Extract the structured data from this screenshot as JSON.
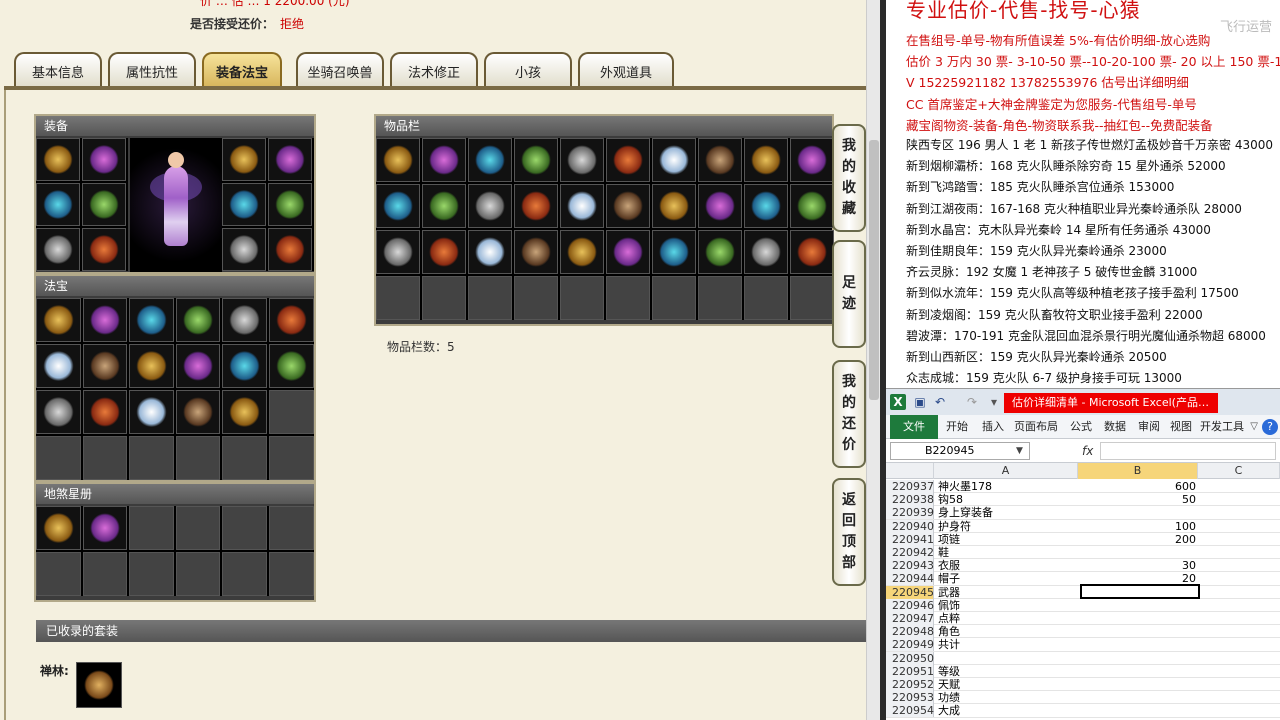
{
  "game": {
    "top_cut_text": "价 … 估 … 1 2200.00 (元)",
    "offer_label": "是否接受还价：",
    "offer_value": "拒绝",
    "tabs": [
      "基本信息",
      "属性抗性",
      "装备法宝",
      "坐骑召唤兽",
      "法术修正",
      "小孩",
      "外观道具"
    ],
    "active_tab": "装备法宝",
    "panels": {
      "equipment": "装备",
      "treasures": "法宝",
      "star_book": "地煞星册",
      "inventory": "物品栏",
      "suits": "已收录的套装"
    },
    "inventory_count": "物品栏数：5",
    "suit_row_label": "禅林:",
    "side_buttons": [
      {
        "chars": [
          "我",
          "的",
          "收",
          "藏"
        ]
      },
      {
        "chars": [
          "足",
          "迹"
        ]
      },
      {
        "chars": [
          "我",
          "的",
          "还",
          "价"
        ]
      },
      {
        "chars": [
          "返",
          "回",
          "顶",
          "部"
        ]
      }
    ]
  },
  "doc": {
    "heading": "专业估价-代售-找号-心猿",
    "lines": [
      {
        "text": "在售组号-单号-物有所值误差 5%-有估价明细-放心选购",
        "red": true
      },
      {
        "text": "估价 3 万内 30 票- 3-10-50 票--10-20-100 票- 20 以上 150 票-1 票 1 元",
        "red": true
      },
      {
        "text": "V 15225921182    13782553976    估号出详细明细",
        "red": true
      },
      {
        "text": "CC 首席鉴定+大神金牌鉴定为您服务-代售组号-单号",
        "red": true
      },
      {
        "text": "藏宝阁物资-装备-角色-物资联系我--抽红包--免费配装备",
        "red": true
      },
      {
        "text": "陕西专区 196 男人 1 老 1 新孩子传世燃灯孟极妙音千万亲密 43000",
        "red": false
      },
      {
        "text": "新到烟柳灞桥：168 克火队睡杀除穷奇 15 星外通杀 52000",
        "red": false
      },
      {
        "text": "新到飞鸿踏雪：185 克火队睡杀宫位通杀 153000",
        "red": false
      },
      {
        "text": "新到江湖夜雨：167-168 克火种植职业异光秦岭通杀队 28000",
        "red": false
      },
      {
        "text": "新到水晶宫：克木队异光秦岭 14 星所有任务通杀 43000",
        "red": false
      },
      {
        "text": "新到佳期良年：159 克火队异光秦岭通杀 23000",
        "red": false
      },
      {
        "text": "齐云灵脉：192 女魔 1 老神孩子 5 破传世金麟 31000",
        "red": false
      },
      {
        "text": "新到似水流年：159 克火队高等级种植老孩子接手盈利 17500",
        "red": false
      },
      {
        "text": "新到凌烟阁：159 克火队畜牧符文职业接手盈利 22000",
        "red": false
      },
      {
        "text": "碧波潭：170-191 克金队混回血混杀景行明光魔仙通杀物超 68000",
        "red": false
      },
      {
        "text": "新到山西新区：159 克火队异光秦岭通杀 20500",
        "red": false
      },
      {
        "text": "众志成城：159 克火队 6-7 级护身接手可玩 13000",
        "red": false
      }
    ],
    "watermark": "飞行运营"
  },
  "excel": {
    "title": "估价详细清单 - Microsoft Excel(产品…",
    "ribbon_tabs": [
      "文件",
      "开始",
      "插入",
      "页面布局",
      "公式",
      "数据",
      "审阅",
      "视图",
      "开发工具"
    ],
    "name_box": "B220945",
    "fx_label": "fx",
    "columns": [
      "A",
      "B",
      "C"
    ],
    "rows": [
      {
        "n": "220937",
        "a": "神火墨178",
        "b": "600"
      },
      {
        "n": "220938",
        "a": "钩58",
        "b": "50"
      },
      {
        "n": "220939",
        "a": "身上穿装备",
        "b": ""
      },
      {
        "n": "220940",
        "a": "护身符",
        "b": "100"
      },
      {
        "n": "220941",
        "a": "项链",
        "b": "200"
      },
      {
        "n": "220942",
        "a": "鞋",
        "b": ""
      },
      {
        "n": "220943",
        "a": "衣服",
        "b": "30"
      },
      {
        "n": "220944",
        "a": "帽子",
        "b": "20"
      },
      {
        "n": "220945",
        "a": "武器",
        "b": ""
      },
      {
        "n": "220946",
        "a": "佩饰",
        "b": ""
      },
      {
        "n": "220947",
        "a": "点粹",
        "b": ""
      },
      {
        "n": "220948",
        "a": "角色",
        "b": ""
      },
      {
        "n": "220949",
        "a": "共计",
        "b": ""
      },
      {
        "n": "220950",
        "a": "",
        "b": ""
      },
      {
        "n": "220951",
        "a": "等级",
        "b": ""
      },
      {
        "n": "220952",
        "a": "天赋",
        "b": ""
      },
      {
        "n": "220953",
        "a": "功绩",
        "b": ""
      },
      {
        "n": "220954",
        "a": "大成",
        "b": ""
      }
    ],
    "selected_row": "220945",
    "selected_col": "B"
  }
}
